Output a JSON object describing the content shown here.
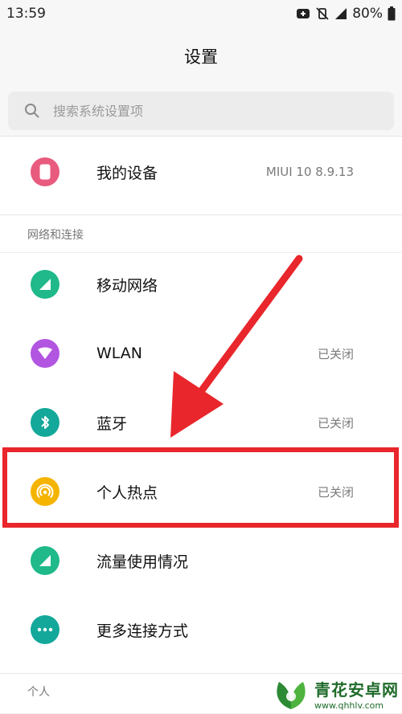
{
  "status_bar": {
    "time": "13:59",
    "battery": "80%"
  },
  "header": {
    "title": "设置"
  },
  "search": {
    "placeholder": "搜索系统设置项"
  },
  "device": {
    "label": "我的设备",
    "value": "MIUI 10 8.9.13",
    "icon": "phone-icon",
    "color": "#e85a7e"
  },
  "sections": {
    "network_label": "网络和连接",
    "personal_label": "个人"
  },
  "network_items": [
    {
      "label": "移动网络",
      "value": "",
      "icon": "mobile-network-icon",
      "color": "#1fb98a"
    },
    {
      "label": "WLAN",
      "value": "已关闭",
      "icon": "wlan-icon",
      "color": "#b255e0"
    },
    {
      "label": "蓝牙",
      "value": "已关闭",
      "icon": "bluetooth-icon",
      "color": "#13a89a"
    },
    {
      "label": "个人热点",
      "value": "已关闭",
      "icon": "hotspot-icon",
      "color": "#f5b400"
    },
    {
      "label": "流量使用情况",
      "value": "",
      "icon": "data-usage-icon",
      "color": "#1fb98a"
    },
    {
      "label": "更多连接方式",
      "value": "",
      "icon": "more-icon",
      "color": "#13a89a"
    }
  ],
  "colors": {
    "highlight": "#e8262b",
    "background": "#f7f7f7"
  },
  "watermark": {
    "title": "青花安卓网",
    "url": "www.qhhlv.com"
  }
}
